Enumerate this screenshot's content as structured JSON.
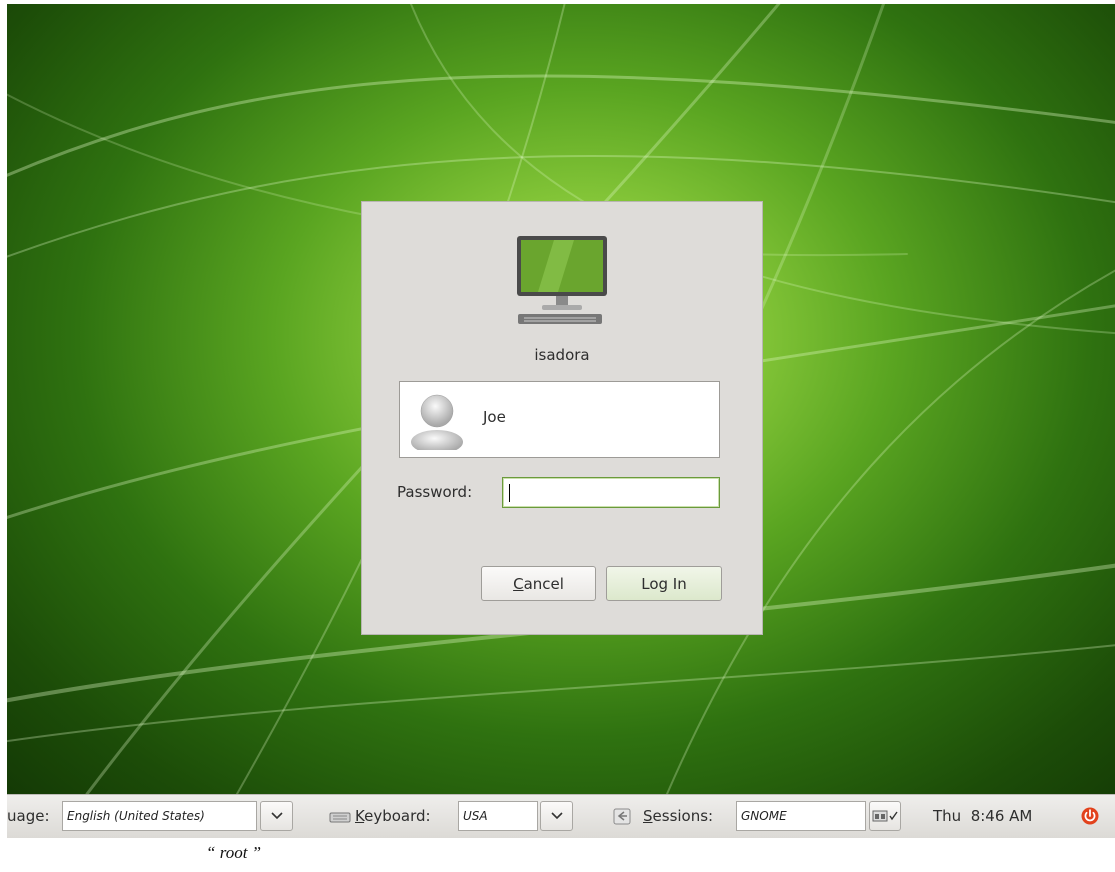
{
  "dialog": {
    "host_name": "isadora",
    "users": [
      {
        "name": "Joe"
      }
    ],
    "password_label": "Password:",
    "password_value": "",
    "cancel_mnemonic": "C",
    "cancel_rest": "ancel",
    "login_label": "Log In"
  },
  "panel": {
    "language_label": "uage:",
    "language_value": "English (United States)",
    "keyboard_mnemonic": "K",
    "keyboard_rest": "eyboard:",
    "keyboard_value": "USA",
    "sessions_mnemonic": "S",
    "sessions_rest": "essions:",
    "sessions_value": "GNOME",
    "clock": "Thu  8:46 AM"
  },
  "caption": "“ root ”",
  "icons": {
    "computer": "computer-icon",
    "user": "user-avatar-icon",
    "keyboard": "keyboard-icon",
    "sessions": "sessions-icon",
    "power": "power-icon",
    "dropdown": "chevron-down-icon"
  },
  "colors": {
    "wallpaper": "#5aa521",
    "dialog_bg": "#dedcd9",
    "panel_bg": "#e6e4e1",
    "power": "#e2421c",
    "focus_border": "#6b9a3c"
  }
}
